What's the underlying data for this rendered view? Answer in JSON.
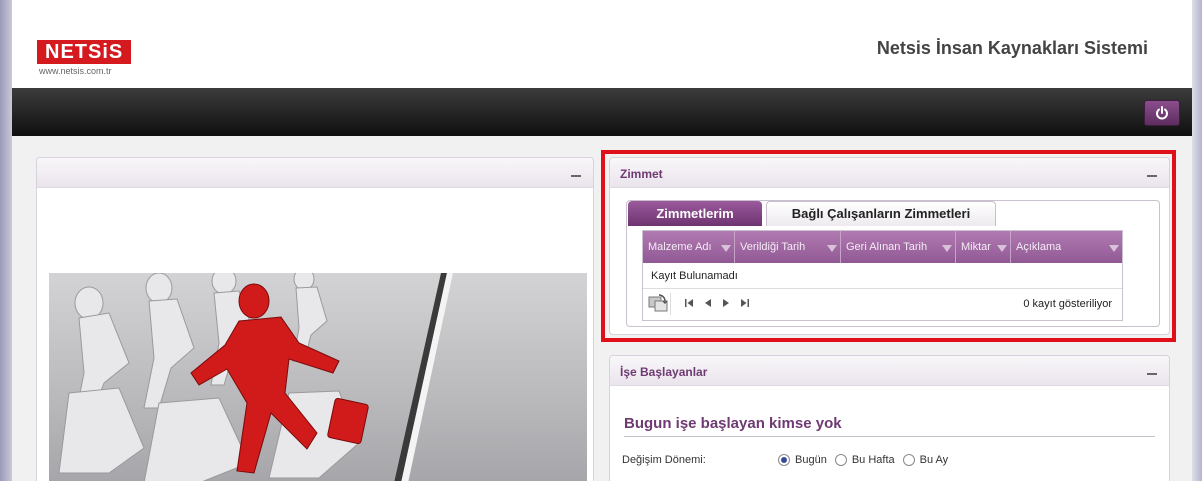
{
  "header": {
    "logo_text": "NETSiS",
    "logo_url": "www.netsis.com.tr",
    "app_title": "Netsis İnsan Kaynakları Sistemi"
  },
  "nav": {
    "power_icon": "power-icon"
  },
  "zimmet": {
    "title": "Zimmet",
    "tabs": [
      {
        "label": "Zimmetlerim",
        "active": true
      },
      {
        "label": "Bağlı Çalışanların Zimmetleri",
        "active": false
      }
    ],
    "columns": [
      "Malzeme Adı",
      "Verildiği Tarih",
      "Geri Alınan Tarih",
      "Miktar",
      "Açıklama"
    ],
    "empty_text": "Kayıt Bulunamadı",
    "pager_info": "0 kayıt gösteriliyor"
  },
  "ise_baslayanlar": {
    "title": "İşe Başlayanlar",
    "message": "Bugun işe başlayan kimse yok",
    "period_label": "Değişim Dönemi:",
    "options": [
      {
        "label": "Bugün",
        "checked": true
      },
      {
        "label": "Bu Hafta",
        "checked": false
      },
      {
        "label": "Bu Ay",
        "checked": false
      }
    ]
  },
  "colors": {
    "accent": "#6e3a72",
    "highlight": "#e0101a",
    "logo": "#d4191f"
  }
}
